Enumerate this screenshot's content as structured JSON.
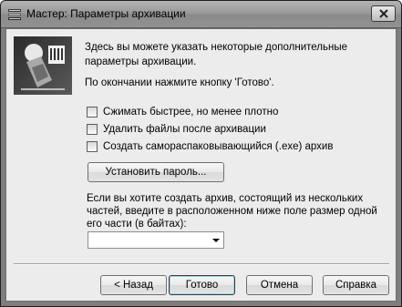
{
  "window": {
    "title": "Мастер:  Параметры архивации",
    "close_symbol": "×",
    "app_icon": "winrar-books-icon"
  },
  "wizard": {
    "image_icon": "wizard-archive-icon",
    "description": "Здесь вы можете указать некоторые дополнительные параметры архивации.",
    "instruction": "По окончании нажмите кнопку 'Готово'."
  },
  "options": [
    {
      "label": "Сжимать быстрее, но менее плотно",
      "checked": false
    },
    {
      "label": "Удалить файлы после архивации",
      "checked": false
    },
    {
      "label": "Создать самораспаковывающийся (.exe) архив",
      "checked": false
    }
  ],
  "password_button": "Установить пароль...",
  "volumes": {
    "text": "Если вы хотите создать архив, состоящий из нескольких частей, введите в расположенном ниже поле размер одной его части (в байтах):",
    "value": ""
  },
  "footer": {
    "back": "< Назад",
    "finish": "Готово",
    "cancel": "Отмена",
    "help": "Справка"
  }
}
